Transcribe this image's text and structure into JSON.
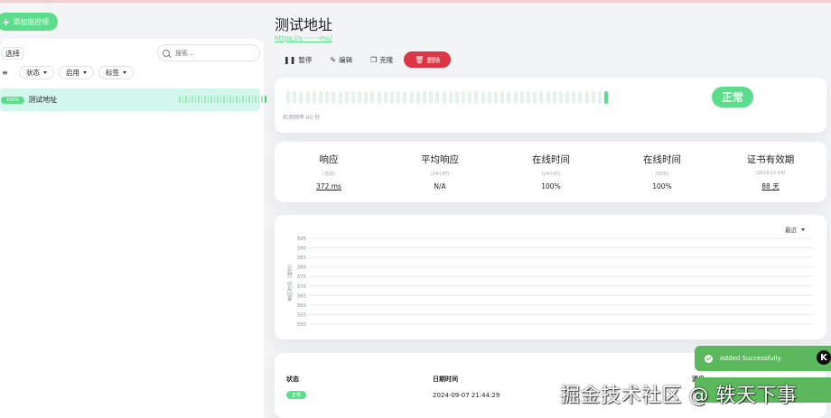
{
  "sidebar": {
    "add_button_label": "添加监控项",
    "select_label": "选择",
    "search_placeholder": "搜索...",
    "filters": [
      "状态",
      "启用",
      "标签"
    ],
    "monitor_items": [
      {
        "uptime_badge": "100%",
        "name": "测试地址"
      }
    ]
  },
  "monitor": {
    "title": "测试地址",
    "url": "https://s········ms/",
    "toolbar": {
      "pause_label": "暂停",
      "edit_label": "编辑",
      "clone_label": "克隆",
      "delete_label": "删除"
    },
    "heartbeat_note": "检测频率 60 秒",
    "status_label": "正常",
    "heartbeats": {
      "total": 50,
      "up": 1
    }
  },
  "stats": [
    {
      "label": "响应",
      "sub": "(当前)",
      "value": "372 ms",
      "underline": true
    },
    {
      "label": "平均响应",
      "sub": "(24小时)",
      "value": "N/A",
      "underline": false
    },
    {
      "label": "在线时间",
      "sub": "(24小时)",
      "value": "100%",
      "underline": false
    },
    {
      "label": "在线时间",
      "sub": "(30天)",
      "value": "100%",
      "underline": false
    },
    {
      "label": "证书有效期",
      "sub": "(2024-12-04)",
      "value": "88 天",
      "underline": true
    }
  ],
  "chart": {
    "period_selector": "最近",
    "chart_data": {
      "type": "line",
      "ylabel": "响应时间（毫秒）",
      "yticks": [
        395,
        390,
        385,
        380,
        375,
        370,
        365,
        360,
        355,
        350
      ],
      "ylim": [
        350,
        395
      ],
      "grid": true,
      "series": []
    }
  },
  "events": {
    "columns": [
      "状态",
      "日期时间",
      "消息"
    ],
    "rows": [
      {
        "status": "正常",
        "datetime": "2024-09-07 21:44:29"
      }
    ]
  },
  "toast": {
    "message": "Added Successfully."
  },
  "watermark": "掘金技术社区 @ 轶天下事",
  "colors": {
    "accent": "#5cdd8b",
    "danger": "#dc3545",
    "toast": "#5cb85c"
  }
}
